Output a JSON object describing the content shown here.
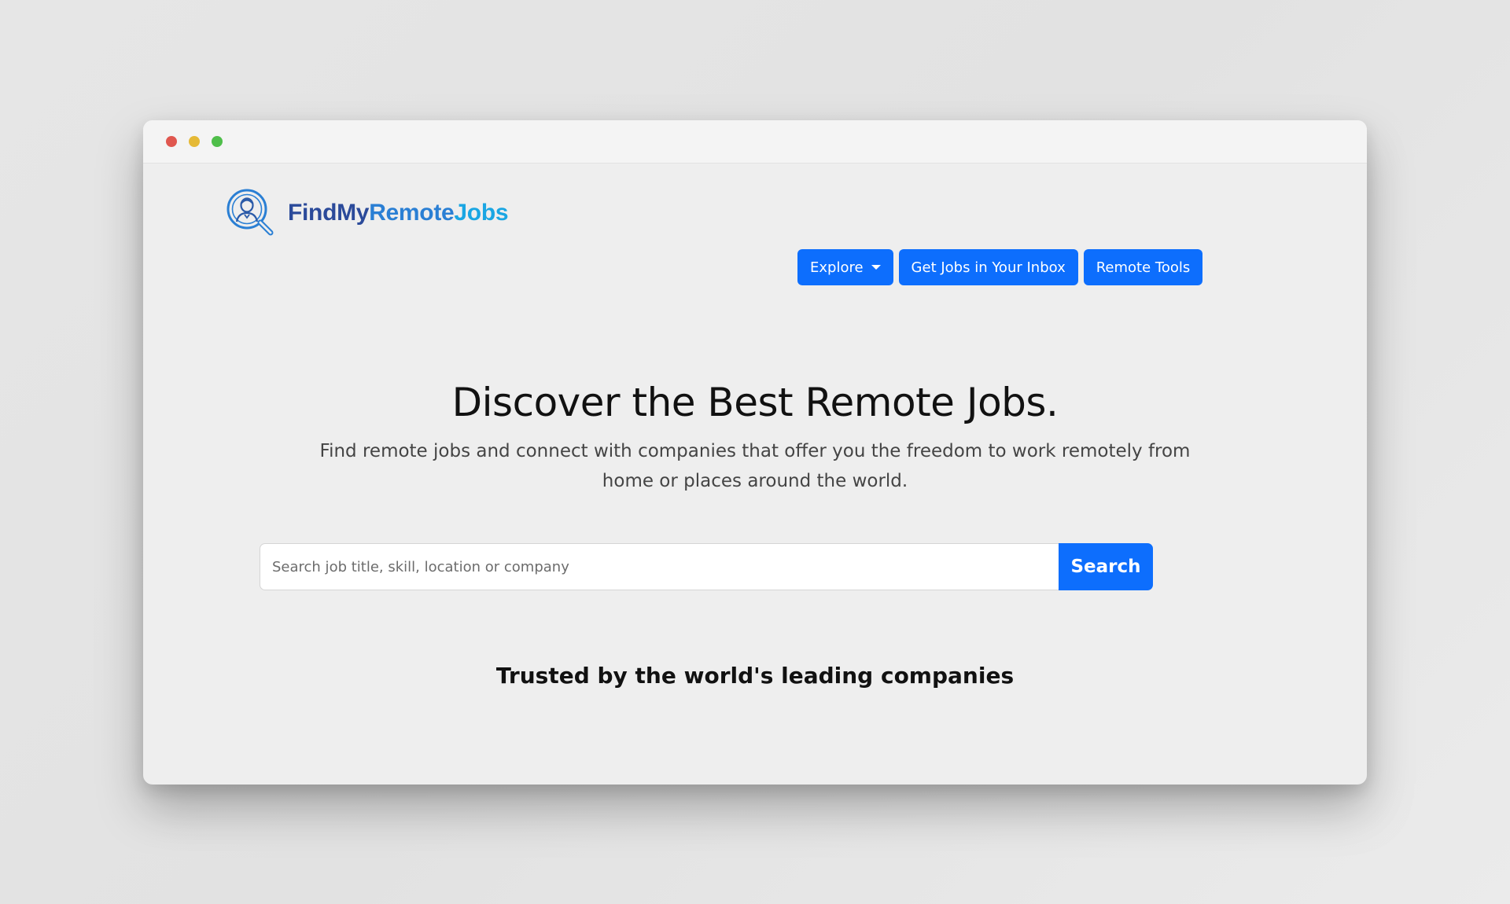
{
  "window": {
    "controls": [
      "close",
      "minimize",
      "maximize"
    ]
  },
  "brand": {
    "name_part1": "FindMy",
    "name_part2": "Remote",
    "name_part3": "Jobs",
    "logo_icon": "magnifier-person-icon",
    "colors": {
      "part1": "#2b4a9a",
      "part2": "#2a7fd4",
      "part3": "#1aa6e3"
    }
  },
  "nav": {
    "explore_label": "Explore",
    "inbox_label": "Get Jobs in Your Inbox",
    "tools_label": "Remote Tools",
    "accent_color": "#0d6efd"
  },
  "hero": {
    "title": "Discover the Best Remote Jobs.",
    "subtitle": "Find remote jobs and connect with companies that offer you the freedom to work remotely from home or places around the world."
  },
  "search": {
    "placeholder": "Search job title, skill, location or company",
    "value": "",
    "button_label": "Search"
  },
  "trusted": {
    "heading": "Trusted by the world's leading companies"
  }
}
